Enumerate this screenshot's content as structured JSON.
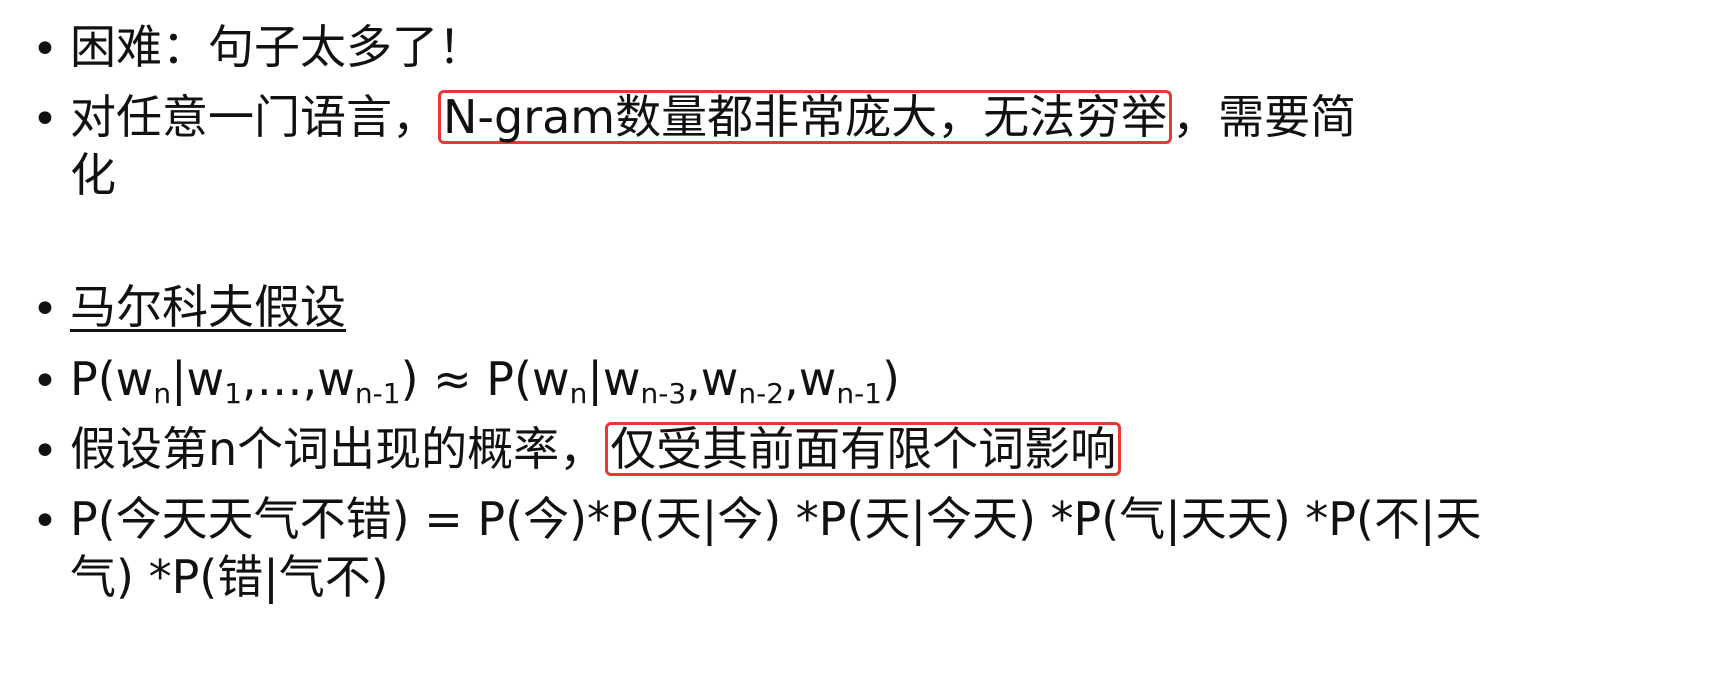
{
  "bullets": {
    "b1": {
      "text": "困难：句子太多了！"
    },
    "b2": {
      "before": "对任意一门语言，",
      "highlight": "N-gram数量都非常庞大，无法穷举",
      "after": "，需要简",
      "cont": "化"
    },
    "b3": {
      "text": "马尔科夫假设"
    },
    "b4": {
      "p1": "P(w",
      "s1": "n",
      "p2": "|w",
      "s2": "1",
      "p3": ",…,w",
      "s3": "n-1",
      "p4": ") ≈ P(w",
      "s4": "n",
      "p5": "|w",
      "s5": "n-3",
      "p6": ",w",
      "s6": "n-2",
      "p7": ",w",
      "s7": "n-1",
      "p8": ")"
    },
    "b5": {
      "before": "假设第n个词出现的概率，",
      "highlight": "仅受其前面有限个词影响"
    },
    "b6": {
      "line1": "P(今天天气不错) = P(今)*P(天|今) *P(天|今天) *P(气|天天) *P(不|天",
      "line2": "气) *P(错|气不)"
    }
  },
  "colors": {
    "highlight_border": "#e53935",
    "text": "#111111"
  }
}
